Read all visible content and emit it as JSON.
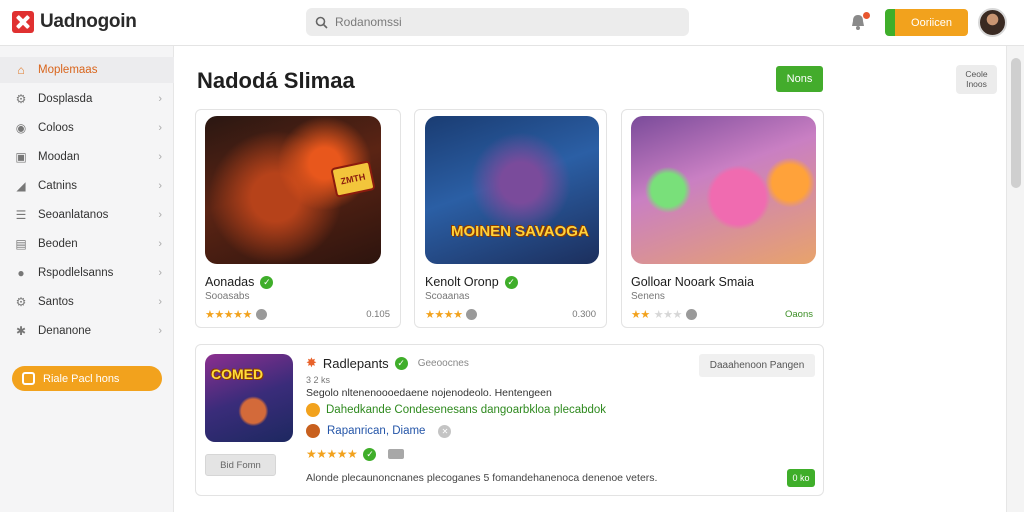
{
  "app": {
    "title": "Uadnogoin"
  },
  "search": {
    "placeholder": "Rodanomssi",
    "icon": "search-icon"
  },
  "header": {
    "action_button": "Ooriicen",
    "notification_dot_color": "#e8562e"
  },
  "sidebar": {
    "items": [
      {
        "label": "Moplemaas",
        "icon": "home-icon",
        "active": true
      },
      {
        "label": "Dosplasda",
        "icon": "settings-icon"
      },
      {
        "label": "Coloos",
        "icon": "gamepad-icon"
      },
      {
        "label": "Moodan",
        "icon": "media-icon"
      },
      {
        "label": "Catnins",
        "icon": "chart-icon"
      },
      {
        "label": "Seoanlatanos",
        "icon": "list-icon"
      },
      {
        "label": "Beoden",
        "icon": "book-icon"
      },
      {
        "label": "Rspodlelsanns",
        "icon": "user-icon"
      },
      {
        "label": "Santos",
        "icon": "settings-icon"
      },
      {
        "label": "Denanone",
        "icon": "gear-icon"
      }
    ],
    "cta_label": "Riale Pacl hons"
  },
  "main": {
    "title": "Nadodá Slimaa",
    "new_button": "Nons",
    "side_button": "Ceole Inoos",
    "cards": [
      {
        "name": "Aonadas",
        "subtitle": "Sooasabs",
        "stars": 5,
        "meta": "0.105",
        "art_text": "ZMTH"
      },
      {
        "name": "Kenolt Oronp",
        "subtitle": "Scoaanas",
        "stars": 4,
        "meta": "0.300",
        "art_text": "MOINEN SAVAOGA"
      },
      {
        "name": "Golloar Nooark Smaia",
        "subtitle": "Senens",
        "stars": 2,
        "meta": "Oaons"
      }
    ],
    "featured": {
      "title": "Radlepants",
      "category": "Geeoocnes",
      "pill": "Daaahenoon Pangen",
      "small_text": "3 2 ks",
      "description": "Segolo nltenenoooedaene nojenodeolo. Hentengeen",
      "features": "Dahedkande Condesenesans dangoarbkloa plecabdok",
      "developer": "Rapanrican, Diame",
      "stars": 5,
      "ghost_button": "Bid Fomn",
      "footer": "Alonde plecaunoncnanes plecoganes 5 fomandehanenoca denenoe veters.",
      "count": "0 ko",
      "art_text": "COMED"
    }
  }
}
